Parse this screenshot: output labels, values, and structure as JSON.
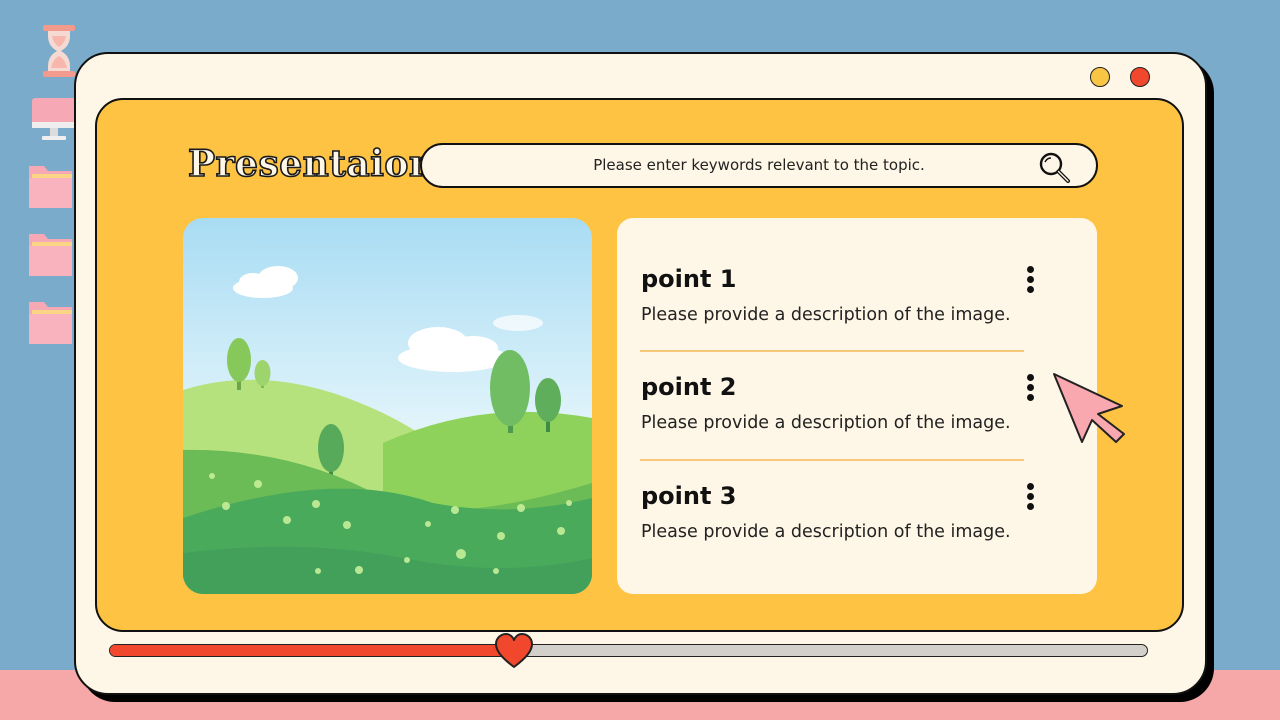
{
  "window": {
    "title": "Presentaion",
    "controls": [
      "minimize-button",
      "close-button"
    ]
  },
  "search": {
    "placeholder": "Please enter keywords relevant to the topic.",
    "icon": "search-icon"
  },
  "points": [
    {
      "title": "point 1",
      "description": "Please provide a description of the image."
    },
    {
      "title": "point 2",
      "description": "Please provide a description of the image."
    },
    {
      "title": "point 3",
      "description": "Please provide a description of the image."
    }
  ],
  "progress": {
    "value": 0.39
  },
  "desktop_icons": [
    "hourglass-icon",
    "computer-icon",
    "folder-icon",
    "folder-icon",
    "folder-icon"
  ],
  "colors": {
    "background": "#7aabcb",
    "floor": "#f6a8a8",
    "window": "#fef6e6",
    "panel": "#fec342",
    "accent_red": "#f0472d",
    "accent_yellow": "#f9c545",
    "cursor": "#f9a8b0"
  }
}
